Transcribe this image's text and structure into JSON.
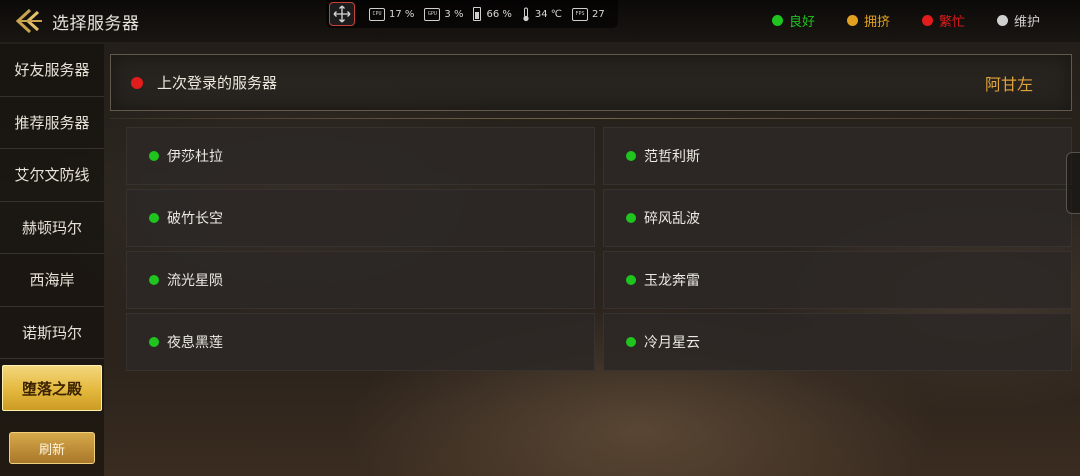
{
  "header": {
    "title": "选择服务器"
  },
  "system_overlay": {
    "cpu_label": "CPU",
    "cpu": "17 %",
    "gpu_label": "GPU",
    "gpu": "3 %",
    "battery": "66 %",
    "temperature": "34 ℃",
    "fps_label": "FPS",
    "fps": "27"
  },
  "legend": [
    {
      "label": "良好",
      "color": "#1fc41f"
    },
    {
      "label": "拥挤",
      "color": "#e2a021"
    },
    {
      "label": "繁忙",
      "color": "#e01c1c"
    },
    {
      "label": "维护",
      "color": "#cfcfcf"
    }
  ],
  "sidebar": {
    "items": [
      {
        "label": "好友服务器"
      },
      {
        "label": "推荐服务器"
      },
      {
        "label": "艾尔文防线"
      },
      {
        "label": "赫顿玛尔"
      },
      {
        "label": "西海岸"
      },
      {
        "label": "诺斯玛尔"
      },
      {
        "label": "堕落之殿",
        "active": true
      }
    ],
    "refresh_label": "刷新"
  },
  "last_login": {
    "label": "上次登录的服务器",
    "server": "阿甘左",
    "status_color": "#e01c1c"
  },
  "servers": [
    {
      "name": "伊莎杜拉",
      "status_color": "#1fc41f"
    },
    {
      "name": "范哲利斯",
      "status_color": "#1fc41f"
    },
    {
      "name": "破竹长空",
      "status_color": "#1fc41f"
    },
    {
      "name": "碎风乱波",
      "status_color": "#1fc41f"
    },
    {
      "name": "流光星陨",
      "status_color": "#1fc41f"
    },
    {
      "name": "玉龙奔雷",
      "status_color": "#1fc41f"
    },
    {
      "name": "夜息黑莲",
      "status_color": "#1fc41f"
    },
    {
      "name": "冷月星云",
      "status_color": "#1fc41f"
    }
  ],
  "colors": {
    "accent_gold": "#e0a23a",
    "active_tab": "#e4b83d"
  }
}
